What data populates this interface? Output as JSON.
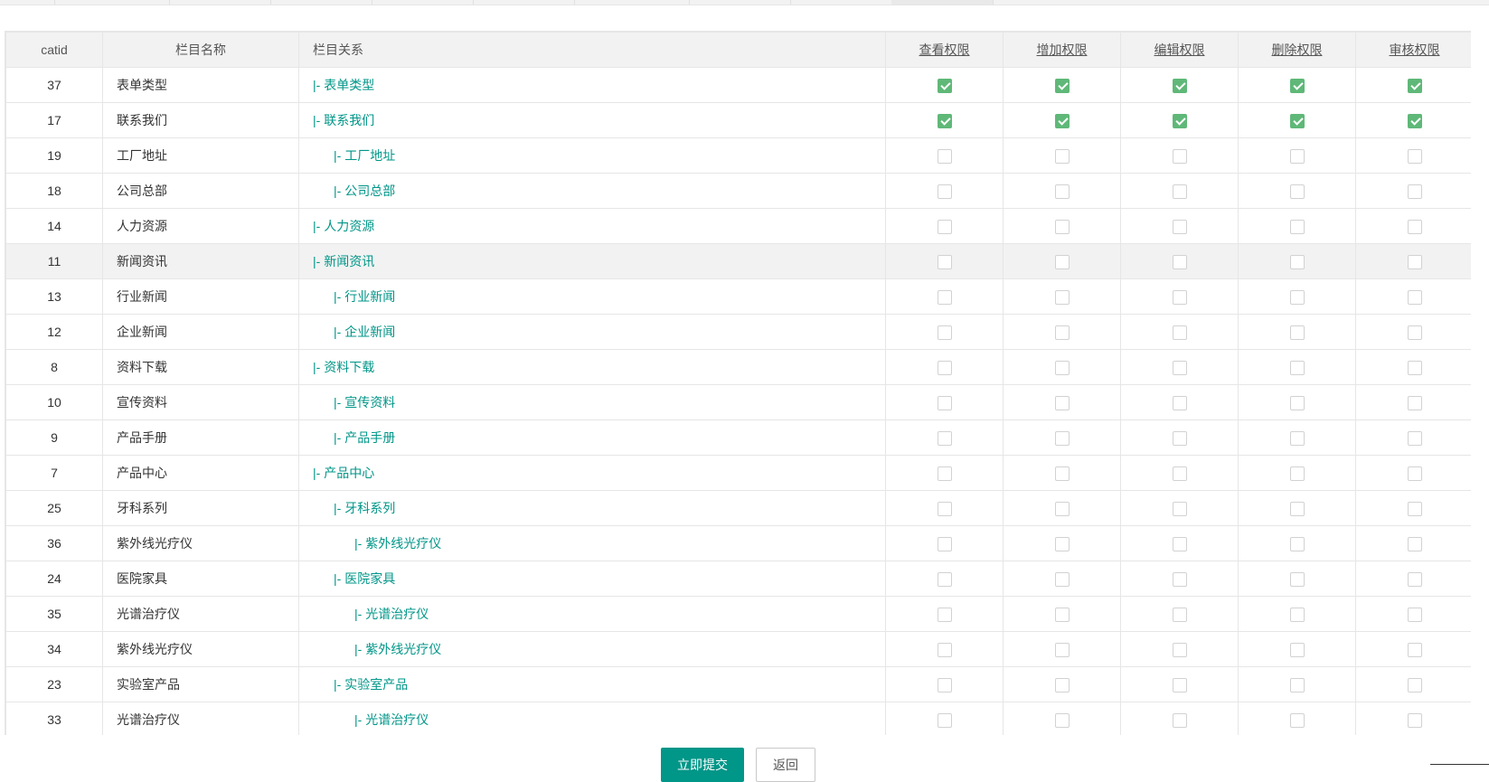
{
  "table": {
    "headers": {
      "catid": "catid",
      "name": "栏目名称",
      "relation": "栏目关系",
      "view": "查看权限",
      "add": "增加权限",
      "edit": "编辑权限",
      "delete": "删除权限",
      "audit": "审核权限"
    },
    "rows": [
      {
        "catid": "37",
        "name": "表单类型",
        "relation": "|- 表单类型",
        "level": 0,
        "perms": [
          true,
          true,
          true,
          true,
          true
        ]
      },
      {
        "catid": "17",
        "name": "联系我们",
        "relation": "|- 联系我们",
        "level": 0,
        "perms": [
          true,
          true,
          true,
          true,
          true
        ]
      },
      {
        "catid": "19",
        "name": "工厂地址",
        "relation": "|- 工厂地址",
        "level": 1,
        "perms": [
          false,
          false,
          false,
          false,
          false
        ]
      },
      {
        "catid": "18",
        "name": "公司总部",
        "relation": "|- 公司总部",
        "level": 1,
        "perms": [
          false,
          false,
          false,
          false,
          false
        ]
      },
      {
        "catid": "14",
        "name": "人力资源",
        "relation": "|- 人力资源",
        "level": 0,
        "perms": [
          false,
          false,
          false,
          false,
          false
        ]
      },
      {
        "catid": "11",
        "name": "新闻资讯",
        "relation": "|- 新闻资讯",
        "level": 0,
        "perms": [
          false,
          false,
          false,
          false,
          false
        ],
        "hover": true
      },
      {
        "catid": "13",
        "name": "行业新闻",
        "relation": "|- 行业新闻",
        "level": 1,
        "perms": [
          false,
          false,
          false,
          false,
          false
        ]
      },
      {
        "catid": "12",
        "name": "企业新闻",
        "relation": "|- 企业新闻",
        "level": 1,
        "perms": [
          false,
          false,
          false,
          false,
          false
        ]
      },
      {
        "catid": "8",
        "name": "资料下载",
        "relation": "|- 资料下载",
        "level": 0,
        "perms": [
          false,
          false,
          false,
          false,
          false
        ]
      },
      {
        "catid": "10",
        "name": "宣传资料",
        "relation": "|- 宣传资料",
        "level": 1,
        "perms": [
          false,
          false,
          false,
          false,
          false
        ]
      },
      {
        "catid": "9",
        "name": "产品手册",
        "relation": "|- 产品手册",
        "level": 1,
        "perms": [
          false,
          false,
          false,
          false,
          false
        ]
      },
      {
        "catid": "7",
        "name": "产品中心",
        "relation": "|- 产品中心",
        "level": 0,
        "perms": [
          false,
          false,
          false,
          false,
          false
        ]
      },
      {
        "catid": "25",
        "name": "牙科系列",
        "relation": "|- 牙科系列",
        "level": 1,
        "perms": [
          false,
          false,
          false,
          false,
          false
        ]
      },
      {
        "catid": "36",
        "name": "紫外线光疗仪",
        "relation": "|- 紫外线光疗仪",
        "level": 2,
        "perms": [
          false,
          false,
          false,
          false,
          false
        ]
      },
      {
        "catid": "24",
        "name": "医院家具",
        "relation": "|- 医院家具",
        "level": 1,
        "perms": [
          false,
          false,
          false,
          false,
          false
        ]
      },
      {
        "catid": "35",
        "name": "光谱治疗仪",
        "relation": "|- 光谱治疗仪",
        "level": 2,
        "perms": [
          false,
          false,
          false,
          false,
          false
        ]
      },
      {
        "catid": "34",
        "name": "紫外线光疗仪",
        "relation": "|- 紫外线光疗仪",
        "level": 2,
        "perms": [
          false,
          false,
          false,
          false,
          false
        ]
      },
      {
        "catid": "23",
        "name": "实验室产品",
        "relation": "|- 实验室产品",
        "level": 1,
        "perms": [
          false,
          false,
          false,
          false,
          false
        ]
      },
      {
        "catid": "33",
        "name": "光谱治疗仪",
        "relation": "|- 光谱治疗仪",
        "level": 2,
        "perms": [
          false,
          false,
          false,
          false,
          false
        ]
      }
    ]
  },
  "footer": {
    "submit_label": "立即提交",
    "back_label": "返回"
  },
  "colors": {
    "accent": "#009688",
    "checked": "#5fb878"
  }
}
